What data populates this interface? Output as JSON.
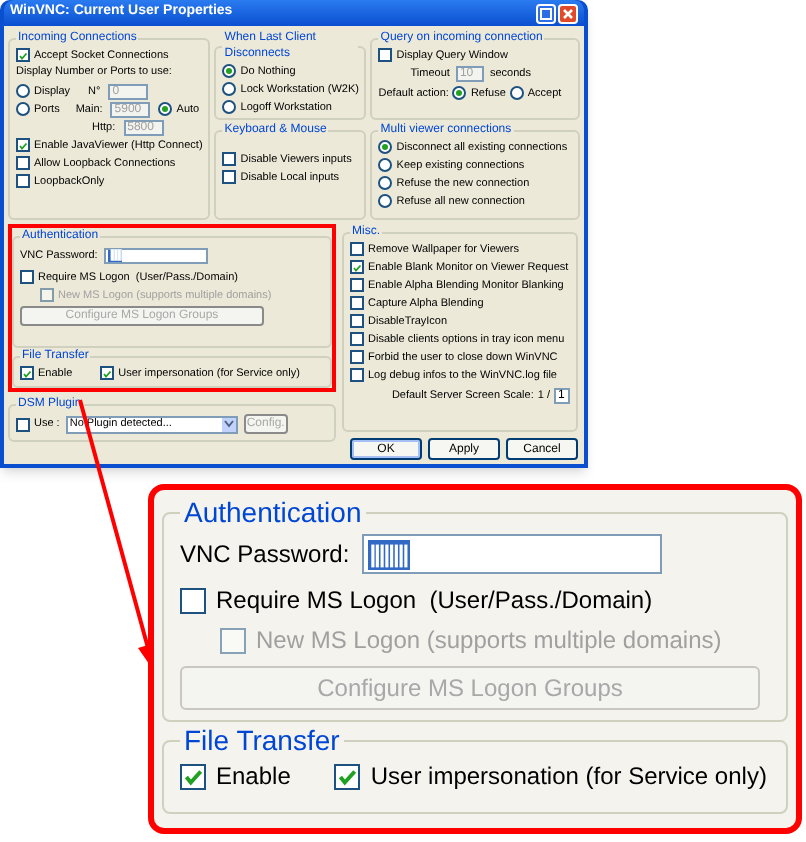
{
  "window": {
    "title": "WinVNC: Current User Properties"
  },
  "incoming": {
    "title": "Incoming Connections",
    "accept_socket": {
      "label": "Accept Socket Connections",
      "checked": true
    },
    "display_label": "Display Number or Ports to use:",
    "display_option": {
      "label": "Display",
      "selected": false
    },
    "ports_option": {
      "label": "Ports",
      "selected": false
    },
    "auto_option": {
      "label": "Auto",
      "selected": true
    },
    "n_label": "N°",
    "n_field": {
      "value": "0",
      "disabled": true
    },
    "main_label": "Main:",
    "main_field": {
      "value": "5900",
      "disabled": true
    },
    "http_label": "Http:",
    "http_field": {
      "value": "5800",
      "disabled": true
    },
    "checks": [
      {
        "label": "Enable JavaViewer (Http Connect)",
        "checked": true
      },
      {
        "label": "Allow Loopback Connections",
        "checked": false
      },
      {
        "label": "LoopbackOnly",
        "checked": false
      }
    ]
  },
  "disconnect": {
    "title": "When Last Client Disconnects",
    "options": [
      {
        "label": "Do Nothing",
        "selected": true
      },
      {
        "label": "Lock Workstation (W2K)",
        "selected": false
      },
      {
        "label": "Logoff Workstation",
        "selected": false
      }
    ]
  },
  "query": {
    "title": "Query on incoming connection",
    "display_query": {
      "label": "Display Query Window",
      "checked": false
    },
    "timeout_label": "Timeout",
    "timeout_field": {
      "value": "10",
      "disabled": true
    },
    "seconds_label": "seconds",
    "default_action_label": "Default action:",
    "actions": [
      {
        "label": "Refuse",
        "selected": true
      },
      {
        "label": "Accept",
        "selected": false
      }
    ]
  },
  "keyboard": {
    "title": "Keyboard & Mouse",
    "checks": [
      {
        "label": "Disable Viewers inputs",
        "checked": false
      },
      {
        "label": "Disable Local inputs",
        "checked": false
      }
    ]
  },
  "multi_viewer": {
    "title": "Multi viewer connections",
    "options": [
      {
        "label": "Disconnect all existing connections",
        "selected": true
      },
      {
        "label": "Keep existing connections",
        "selected": false
      },
      {
        "label": "Refuse the new connection",
        "selected": false
      },
      {
        "label": "Refuse all new connection",
        "selected": false
      }
    ]
  },
  "authentication": {
    "title": "Authentication",
    "password_label": "VNC Password:",
    "password_value": "||||||||",
    "require_ms_logon": {
      "label": "Require MS Logon  (User/Pass./Domain)",
      "checked": false
    },
    "new_ms_logon": {
      "label": "New MS Logon (supports multiple domains)",
      "checked": false,
      "disabled": true
    },
    "configure_button": {
      "label": "Configure MS Logon Groups",
      "disabled": true
    }
  },
  "file_transfer": {
    "title": "File Transfer",
    "checks": [
      {
        "label": "Enable",
        "checked": true
      },
      {
        "label": "User impersonation (for Service only)",
        "checked": true
      }
    ]
  },
  "dsm_plugin": {
    "title": "DSM Plugin",
    "use": {
      "label": "Use :",
      "checked": false
    },
    "select_value": "No Plugin detected...",
    "config_button": {
      "label": "Config.",
      "disabled": true
    }
  },
  "misc": {
    "title": "Misc.",
    "checks": [
      {
        "label": "Remove Wallpaper for Viewers",
        "checked": false
      },
      {
        "label": "Enable Blank Monitor on Viewer Request",
        "checked": true
      },
      {
        "label": "Enable Alpha Blending Monitor Blanking",
        "checked": false
      },
      {
        "label": "Capture Alpha Blending",
        "checked": false
      },
      {
        "label": "DisableTrayIcon",
        "checked": false
      },
      {
        "label": "Disable clients options in tray icon menu",
        "checked": false
      },
      {
        "label": "Forbid the user to close down WinVNC",
        "checked": false
      },
      {
        "label": "Log debug infos to the WinVNC.log file",
        "checked": false
      }
    ],
    "scale_label": "Default Server Screen Scale:",
    "scale_prefix": "1 /",
    "scale_value": "1"
  },
  "buttons": [
    {
      "label": "OK"
    },
    {
      "label": "Apply"
    },
    {
      "label": "Cancel"
    }
  ],
  "callout": {
    "authentication": {
      "title": "Authentication",
      "password_label": "VNC Password:",
      "password_value": "||||||||",
      "require_ms_logon": {
        "label": "Require MS Logon  (User/Pass./Domain)",
        "checked": false
      },
      "new_ms_logon": {
        "label": "New MS Logon (supports multiple domains)",
        "checked": false,
        "disabled": true
      },
      "configure_button": {
        "label": "Configure MS Logon Groups",
        "disabled": true
      }
    },
    "file_transfer": {
      "title": "File Transfer",
      "checks": [
        {
          "label": "Enable",
          "checked": true
        },
        {
          "label": "User impersonation (for Service only)",
          "checked": true
        }
      ]
    }
  }
}
